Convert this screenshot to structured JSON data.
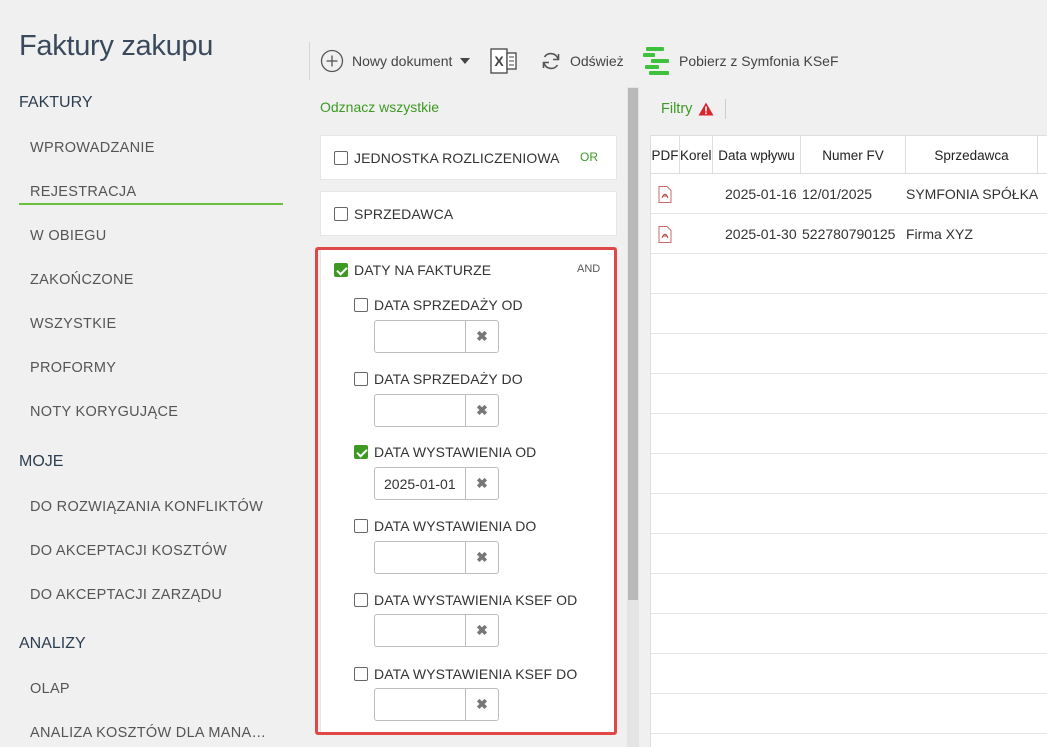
{
  "app_title": "Faktury zakupu",
  "sidebar": {
    "sections": [
      {
        "label": "FAKTURY"
      },
      {
        "label": "MOJE"
      },
      {
        "label": "ANALIZY"
      }
    ],
    "items": [
      {
        "label": "WPROWADZANIE"
      },
      {
        "label": "REJESTRACJA"
      },
      {
        "label": "W OBIEGU"
      },
      {
        "label": "ZAKOŃCZONE"
      },
      {
        "label": "WSZYSTKIE"
      },
      {
        "label": "PROFORMY"
      },
      {
        "label": "NOTY KORYGUJĄCE"
      },
      {
        "label": "DO ROZWIĄZANIA KONFLIKTÓW"
      },
      {
        "label": "DO AKCEPTACJI KOSZTÓW"
      },
      {
        "label": "DO AKCEPTACJI ZARZĄDU"
      },
      {
        "label": "OLAP"
      },
      {
        "label": "ANALIZA KOSZTÓW DLA MANA…"
      }
    ],
    "active_item": "REJESTRACJA"
  },
  "toolbar": {
    "new_document": "Nowy dokument",
    "excel_icon": "excel-icon",
    "refresh": "Odśwież",
    "download_ksef": "Pobierz z Symfonia KSeF"
  },
  "filters_panel": {
    "select_all": "Odznacz wszystkie",
    "groups": [
      {
        "label": "JEDNOSTKA ROZLICZENIOWA",
        "checked": false,
        "operator": "OR"
      },
      {
        "label": "SPRZEDAWCA",
        "checked": false
      },
      {
        "label": "DATY NA FAKTURZE",
        "checked": true,
        "operator": "AND"
      }
    ],
    "date_filters": [
      {
        "label": "DATA SPRZEDAŻY OD",
        "checked": false,
        "value": ""
      },
      {
        "label": "DATA SPRZEDAŻY DO",
        "checked": false,
        "value": ""
      },
      {
        "label": "DATA WYSTAWIENIA OD",
        "checked": true,
        "value": "2025-01-01"
      },
      {
        "label": "DATA WYSTAWIENIA DO",
        "checked": false,
        "value": ""
      },
      {
        "label": "DATA WYSTAWIENIA KSEF OD",
        "checked": false,
        "value": ""
      },
      {
        "label": "DATA WYSTAWIENIA KSEF DO",
        "checked": false,
        "value": ""
      }
    ],
    "clear_glyph": "✖"
  },
  "grid": {
    "filters_label": "Filtry",
    "columns": [
      "PDF",
      "Korel",
      "Data wpływu",
      "Numer FV",
      "Sprzedawca"
    ],
    "rows": [
      {
        "data_wplywu": "2025-01-16",
        "numer_fv": "12/01/2025",
        "sprzedawca": "SYMFONIA SPÓŁKA"
      },
      {
        "data_wplywu": "2025-01-30",
        "numer_fv": "522780790125",
        "sprzedawca": "Firma XYZ"
      }
    ]
  },
  "colors": {
    "accent_green": "#3c9a22",
    "highlight_red": "#e04848",
    "warning_red": "#d9262e"
  }
}
